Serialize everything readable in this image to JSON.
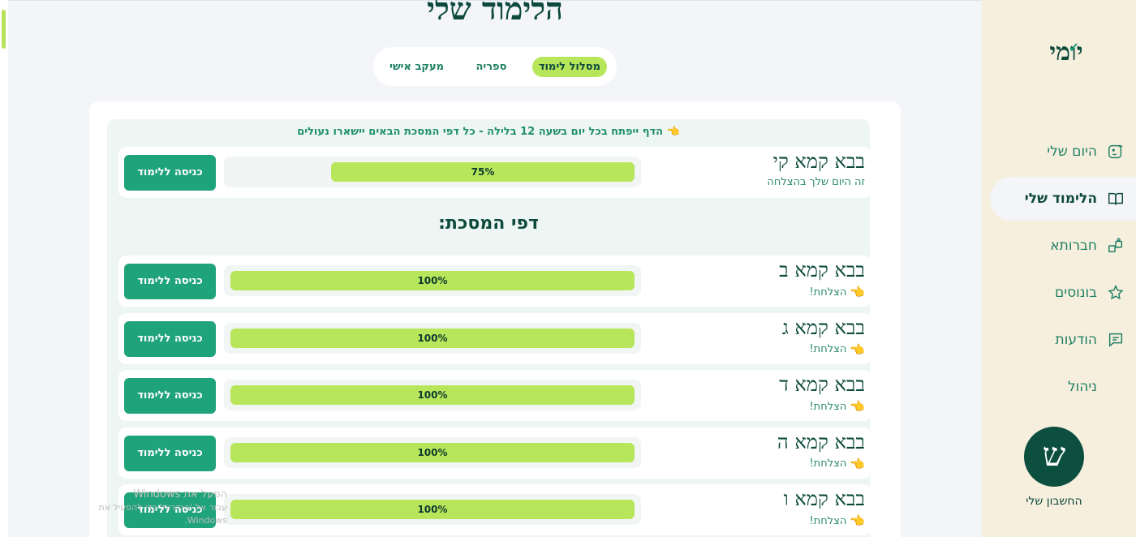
{
  "page": {
    "title": "הלימוד שלי"
  },
  "tabs": [
    {
      "label": "מסלול לימוד",
      "active": true
    },
    {
      "label": "ספריה",
      "active": false
    },
    {
      "label": "מעקב אישי",
      "active": false
    }
  ],
  "sidebar": {
    "logo": "יומי",
    "items": [
      {
        "label": "היום שלי",
        "icon": "face-icon",
        "active": false
      },
      {
        "label": "הלימוד שלי",
        "icon": "book-icon",
        "active": true
      },
      {
        "label": "חברותא",
        "icon": "puzzle-icon",
        "active": false
      },
      {
        "label": "בונוסים",
        "icon": "star-icon",
        "active": false
      },
      {
        "label": "הודעות",
        "icon": "chat-icon",
        "active": false
      },
      {
        "label": "ניהול",
        "icon": "",
        "active": false
      }
    ],
    "avatar_letter": "ש",
    "account_label": "החשבון שלי"
  },
  "notice": "הדף ייפתח בכל יום בשעה 12 בלילה - כל דפי המסכת הבאים יישארו נעולים",
  "current": {
    "title": "בבא קמא קי",
    "subtitle": "זה היום שלך בהצלחה",
    "progress_label": "75%",
    "progress": 0.75,
    "button": "כניסה ללימוד"
  },
  "section_heading": "דפי המסכת:",
  "pages": [
    {
      "title": "בבא קמא ב",
      "subtitle": "הצלחת!",
      "progress_label": "100%",
      "progress": 1.0,
      "button": "כניסה ללימוד"
    },
    {
      "title": "בבא קמא ג",
      "subtitle": "הצלחת!",
      "progress_label": "100%",
      "progress": 1.0,
      "button": "כניסה ללימוד"
    },
    {
      "title": "בבא קמא ד",
      "subtitle": "הצלחת!",
      "progress_label": "100%",
      "progress": 1.0,
      "button": "כניסה ללימוד"
    },
    {
      "title": "בבא קמא ה",
      "subtitle": "הצלחת!",
      "progress_label": "100%",
      "progress": 1.0,
      "button": "כניסה ללימוד"
    },
    {
      "title": "בבא קמא ו",
      "subtitle": "הצלחת!",
      "progress_label": "100%",
      "progress": 1.0,
      "button": "כניסה ללימוד"
    }
  ],
  "watermark": {
    "line1": "הפעל את Windows",
    "line2": "עבור אל 'הגדרות' כדי להפעיל את Windows."
  },
  "colors": {
    "accent": "#1fa37a",
    "progress": "#b8e65a",
    "dark": "#0d4a3c"
  }
}
